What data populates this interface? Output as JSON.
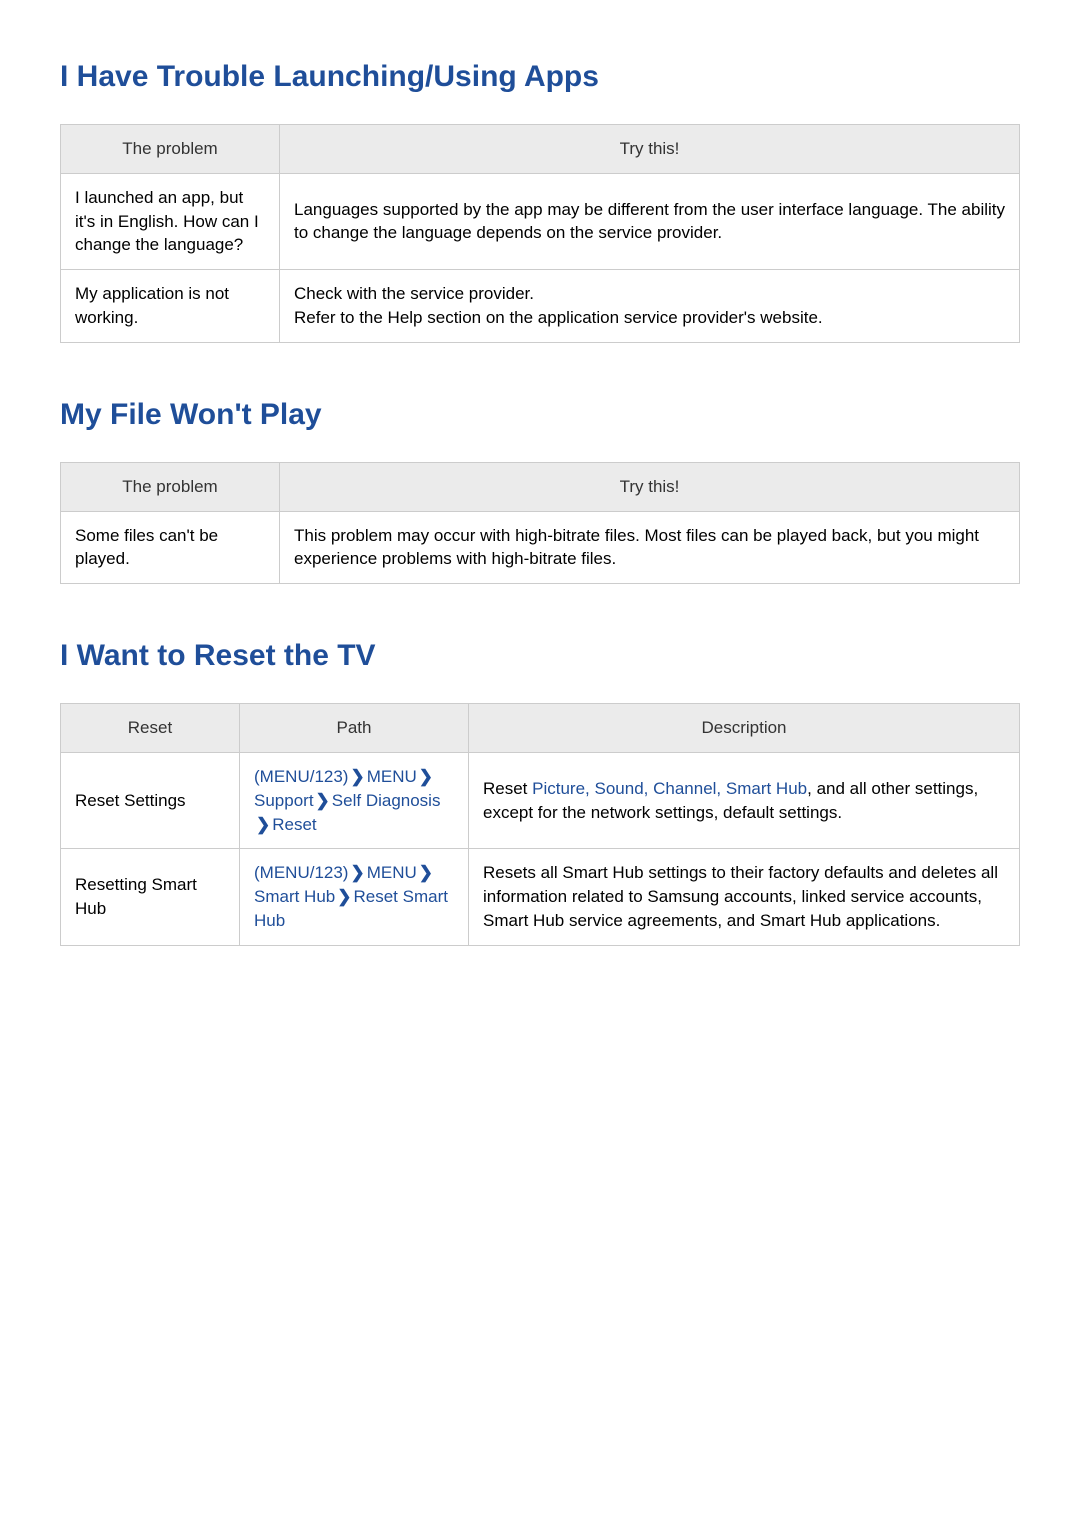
{
  "sections": {
    "apps": {
      "title": "I Have Trouble Launching/Using Apps",
      "headers": {
        "problem": "The problem",
        "try": "Try this!"
      },
      "rows": [
        {
          "problem": "I launched an app, but it's in English. How can I change the language?",
          "try": "Languages supported by the app may be different from the user interface language. The ability to change the language depends on the service provider."
        },
        {
          "problem": "My application is not working.",
          "try": "Check with the service provider.\nRefer to the Help section on the application service provider's website."
        }
      ]
    },
    "file": {
      "title": "My File Won't Play",
      "headers": {
        "problem": "The problem",
        "try": "Try this!"
      },
      "rows": [
        {
          "problem": "Some files can't be played.",
          "try": "This problem may occur with high-bitrate files. Most files can be played back, but you might experience problems with high-bitrate files."
        }
      ]
    },
    "reset": {
      "title": "I Want to Reset the TV",
      "headers": {
        "reset": "Reset",
        "path": "Path",
        "desc": "Description"
      },
      "rows": [
        {
          "reset": "Reset Settings",
          "path_segments": [
            "MENU/123",
            "MENU",
            "Support",
            "Self Diagnosis",
            "Reset"
          ],
          "desc_prefix": "Reset ",
          "desc_accent": "Picture, Sound, Channel, Smart Hub",
          "desc_suffix": ", and all other settings, except for the network settings, default settings."
        },
        {
          "reset": "Resetting Smart Hub",
          "path_segments": [
            "MENU/123",
            "MENU",
            "Smart Hub",
            "Reset Smart Hub"
          ],
          "desc_prefix": "",
          "desc_accent": "",
          "desc_suffix": "Resets all Smart Hub settings to their factory defaults and deletes all information related to Samsung accounts, linked service accounts, Smart Hub service agreements, and Smart Hub applications."
        }
      ]
    }
  },
  "path_parens": {
    "open": "(",
    "close": ")"
  }
}
